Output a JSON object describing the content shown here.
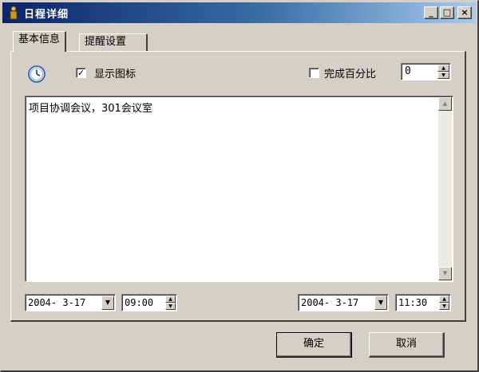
{
  "window": {
    "title": "日程详细",
    "controls": {
      "minimize": "_",
      "maximize": "□",
      "close": "×"
    }
  },
  "tabs": [
    {
      "label": "基本信息",
      "active": true
    },
    {
      "label": "提醒设置",
      "active": false
    }
  ],
  "options": {
    "show_icon": {
      "label": "显示图标",
      "checked": true,
      "mark": "✓"
    },
    "percent_complete": {
      "label": "完成百分比",
      "checked": false,
      "value": "0"
    }
  },
  "memo": {
    "text": "项目协调会议，301会议室"
  },
  "start": {
    "date": "2004- 3-17",
    "time": "09:00"
  },
  "end": {
    "date": "2004- 3-17",
    "time": "11:30"
  },
  "buttons": {
    "ok": "确定",
    "cancel": "取消"
  },
  "icons": {
    "app": "app-icon",
    "clock": "clock-icon"
  }
}
